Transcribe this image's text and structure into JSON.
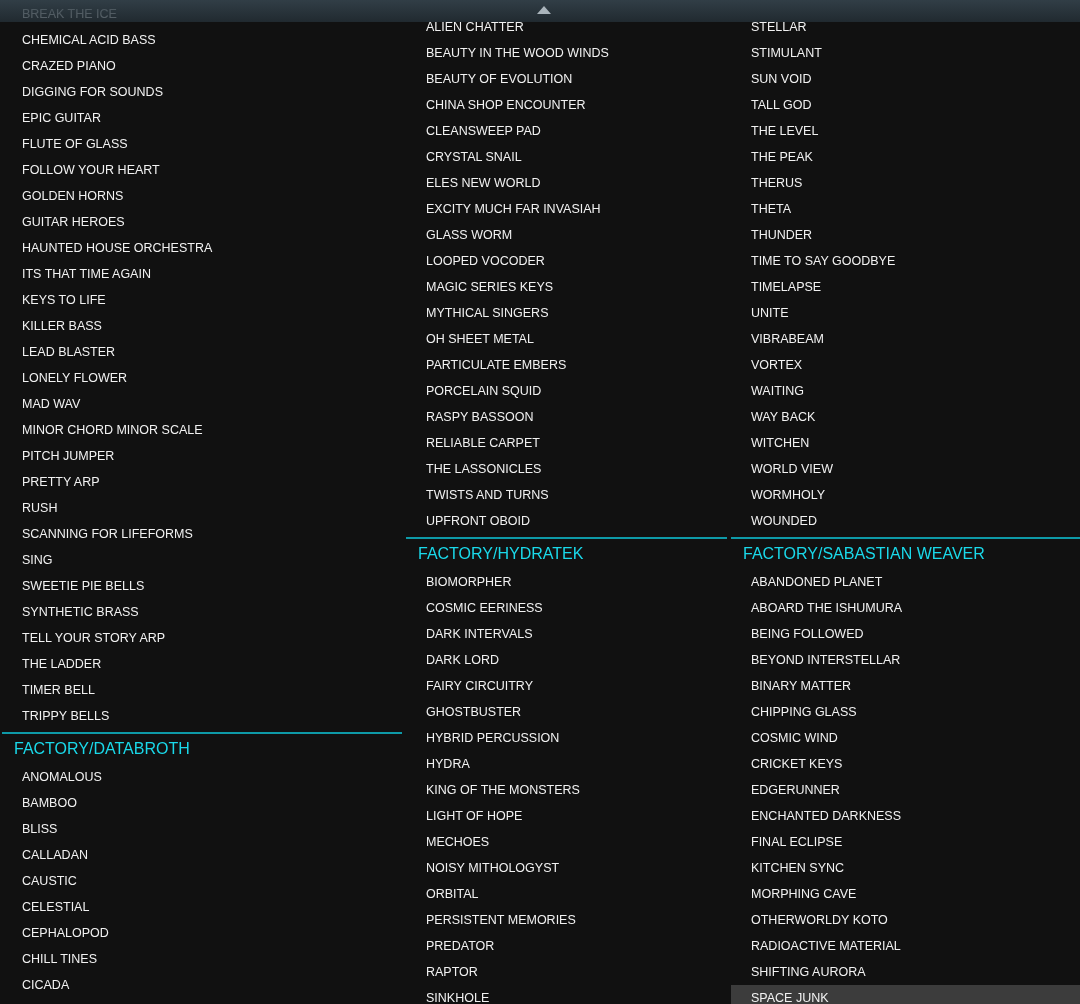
{
  "columns": [
    {
      "groups": [
        {
          "items": [
            {
              "label": "BREAK THE ICE",
              "selected": false
            },
            {
              "label": "CHEMICAL ACID BASS",
              "selected": false
            },
            {
              "label": "CRAZED PIANO",
              "selected": false
            },
            {
              "label": "DIGGING FOR SOUNDS",
              "selected": false
            },
            {
              "label": "EPIC GUITAR",
              "selected": false
            },
            {
              "label": "FLUTE OF GLASS",
              "selected": false
            },
            {
              "label": "FOLLOW YOUR HEART",
              "selected": false
            },
            {
              "label": "GOLDEN HORNS",
              "selected": false
            },
            {
              "label": "GUITAR HEROES",
              "selected": false
            },
            {
              "label": "HAUNTED HOUSE ORCHESTRA",
              "selected": false
            },
            {
              "label": "ITS THAT TIME AGAIN",
              "selected": false
            },
            {
              "label": "KEYS TO LIFE",
              "selected": false
            },
            {
              "label": "KILLER BASS",
              "selected": false
            },
            {
              "label": "LEAD BLASTER",
              "selected": false
            },
            {
              "label": "LONELY FLOWER",
              "selected": false
            },
            {
              "label": "MAD WAV",
              "selected": false
            },
            {
              "label": "MINOR CHORD MINOR SCALE",
              "selected": false
            },
            {
              "label": "PITCH JUMPER",
              "selected": false
            },
            {
              "label": "PRETTY ARP",
              "selected": false
            },
            {
              "label": "RUSH",
              "selected": false
            },
            {
              "label": "SCANNING FOR LIFEFORMS",
              "selected": false
            },
            {
              "label": "SING",
              "selected": false
            },
            {
              "label": "SWEETIE PIE BELLS",
              "selected": false
            },
            {
              "label": "SYNTHETIC BRASS",
              "selected": false
            },
            {
              "label": "TELL YOUR STORY ARP",
              "selected": false
            },
            {
              "label": "THE LADDER",
              "selected": false
            },
            {
              "label": "TIMER BELL",
              "selected": false
            },
            {
              "label": "TRIPPY BELLS",
              "selected": false
            }
          ]
        },
        {
          "header": "FACTORY/DATABROTH",
          "items": [
            {
              "label": "ANOMALOUS",
              "selected": false
            },
            {
              "label": "BAMBOO",
              "selected": false
            },
            {
              "label": "BLISS",
              "selected": false
            },
            {
              "label": "CALLADAN",
              "selected": false
            },
            {
              "label": "CAUSTIC",
              "selected": false
            },
            {
              "label": "CELESTIAL",
              "selected": false
            },
            {
              "label": "CEPHALOPOD",
              "selected": false
            },
            {
              "label": "CHILL TINES",
              "selected": false
            },
            {
              "label": "CICADA",
              "selected": false
            }
          ]
        }
      ]
    },
    {
      "groups": [
        {
          "items": [
            {
              "label": "ALIEN CHATTER",
              "selected": false
            },
            {
              "label": "BEAUTY IN THE WOOD WINDS",
              "selected": false
            },
            {
              "label": "BEAUTY OF EVOLUTION",
              "selected": false
            },
            {
              "label": "CHINA SHOP ENCOUNTER",
              "selected": false
            },
            {
              "label": "CLEANSWEEP PAD",
              "selected": false
            },
            {
              "label": "CRYSTAL SNAIL",
              "selected": false
            },
            {
              "label": "ELES NEW WORLD",
              "selected": false
            },
            {
              "label": "EXCITY MUCH FAR INVASIAH",
              "selected": false
            },
            {
              "label": "GLASS WORM",
              "selected": false
            },
            {
              "label": "LOOPED VOCODER",
              "selected": false
            },
            {
              "label": "MAGIC SERIES KEYS",
              "selected": false
            },
            {
              "label": "MYTHICAL SINGERS",
              "selected": false
            },
            {
              "label": "OH SHEET METAL",
              "selected": false
            },
            {
              "label": "PARTICULATE EMBERS",
              "selected": false
            },
            {
              "label": "PORCELAIN SQUID",
              "selected": false
            },
            {
              "label": "RASPY BASSOON",
              "selected": false
            },
            {
              "label": "RELIABLE CARPET",
              "selected": false
            },
            {
              "label": "THE LASSONICLES",
              "selected": false
            },
            {
              "label": "TWISTS AND TURNS",
              "selected": false
            },
            {
              "label": "UPFRONT OBOID",
              "selected": false
            }
          ]
        },
        {
          "header": "FACTORY/HYDRATEK",
          "items": [
            {
              "label": "BIOMORPHER",
              "selected": false
            },
            {
              "label": "COSMIC EERINESS",
              "selected": false
            },
            {
              "label": "DARK INTERVALS",
              "selected": false
            },
            {
              "label": "DARK LORD",
              "selected": false
            },
            {
              "label": "FAIRY CIRCUITRY",
              "selected": false
            },
            {
              "label": "GHOSTBUSTER",
              "selected": false
            },
            {
              "label": "HYBRID PERCUSSION",
              "selected": false
            },
            {
              "label": "HYDRA",
              "selected": false
            },
            {
              "label": "KING OF THE MONSTERS",
              "selected": false
            },
            {
              "label": "LIGHT OF HOPE",
              "selected": false
            },
            {
              "label": "MECHOES",
              "selected": false
            },
            {
              "label": "NOISY MITHOLOGYST",
              "selected": false
            },
            {
              "label": "ORBITAL",
              "selected": false
            },
            {
              "label": "PERSISTENT MEMORIES",
              "selected": false
            },
            {
              "label": "PREDATOR",
              "selected": false
            },
            {
              "label": "RAPTOR",
              "selected": false
            },
            {
              "label": "SINKHOLE",
              "selected": false
            }
          ]
        }
      ]
    },
    {
      "groups": [
        {
          "items": [
            {
              "label": "STELLAR",
              "selected": false
            },
            {
              "label": "STIMULANT",
              "selected": false
            },
            {
              "label": "SUN VOID",
              "selected": false
            },
            {
              "label": "TALL GOD",
              "selected": false
            },
            {
              "label": "THE LEVEL",
              "selected": false
            },
            {
              "label": "THE PEAK",
              "selected": false
            },
            {
              "label": "THERUS",
              "selected": false
            },
            {
              "label": "THETA",
              "selected": false
            },
            {
              "label": "THUNDER",
              "selected": false
            },
            {
              "label": "TIME TO SAY GOODBYE",
              "selected": false
            },
            {
              "label": "TIMELAPSE",
              "selected": false
            },
            {
              "label": "UNITE",
              "selected": false
            },
            {
              "label": "VIBRABEAM",
              "selected": false
            },
            {
              "label": "VORTEX",
              "selected": false
            },
            {
              "label": "WAITING",
              "selected": false
            },
            {
              "label": "WAY BACK",
              "selected": false
            },
            {
              "label": "WITCHEN",
              "selected": false
            },
            {
              "label": "WORLD VIEW",
              "selected": false
            },
            {
              "label": "WORMHOLY",
              "selected": false
            },
            {
              "label": "WOUNDED",
              "selected": false
            }
          ]
        },
        {
          "header": "FACTORY/SABASTIAN WEAVER",
          "items": [
            {
              "label": "ABANDONED PLANET",
              "selected": false
            },
            {
              "label": "ABOARD THE ISHUMURA",
              "selected": false
            },
            {
              "label": "BEING FOLLOWED",
              "selected": false
            },
            {
              "label": "BEYOND INTERSTELLAR",
              "selected": false
            },
            {
              "label": "BINARY MATTER",
              "selected": false
            },
            {
              "label": "CHIPPING GLASS",
              "selected": false
            },
            {
              "label": "COSMIC WIND",
              "selected": false
            },
            {
              "label": "CRICKET KEYS",
              "selected": false
            },
            {
              "label": "EDGERUNNER",
              "selected": false
            },
            {
              "label": "ENCHANTED DARKNESS",
              "selected": false
            },
            {
              "label": "FINAL ECLIPSE",
              "selected": false
            },
            {
              "label": "KITCHEN SYNC",
              "selected": false
            },
            {
              "label": "MORPHING CAVE",
              "selected": false
            },
            {
              "label": "OTHERWORLDY KOTO",
              "selected": false
            },
            {
              "label": "RADIOACTIVE MATERIAL",
              "selected": false
            },
            {
              "label": "SHIFTING AURORA",
              "selected": false
            },
            {
              "label": "SPACE JUNK",
              "selected": true
            }
          ]
        }
      ]
    }
  ]
}
